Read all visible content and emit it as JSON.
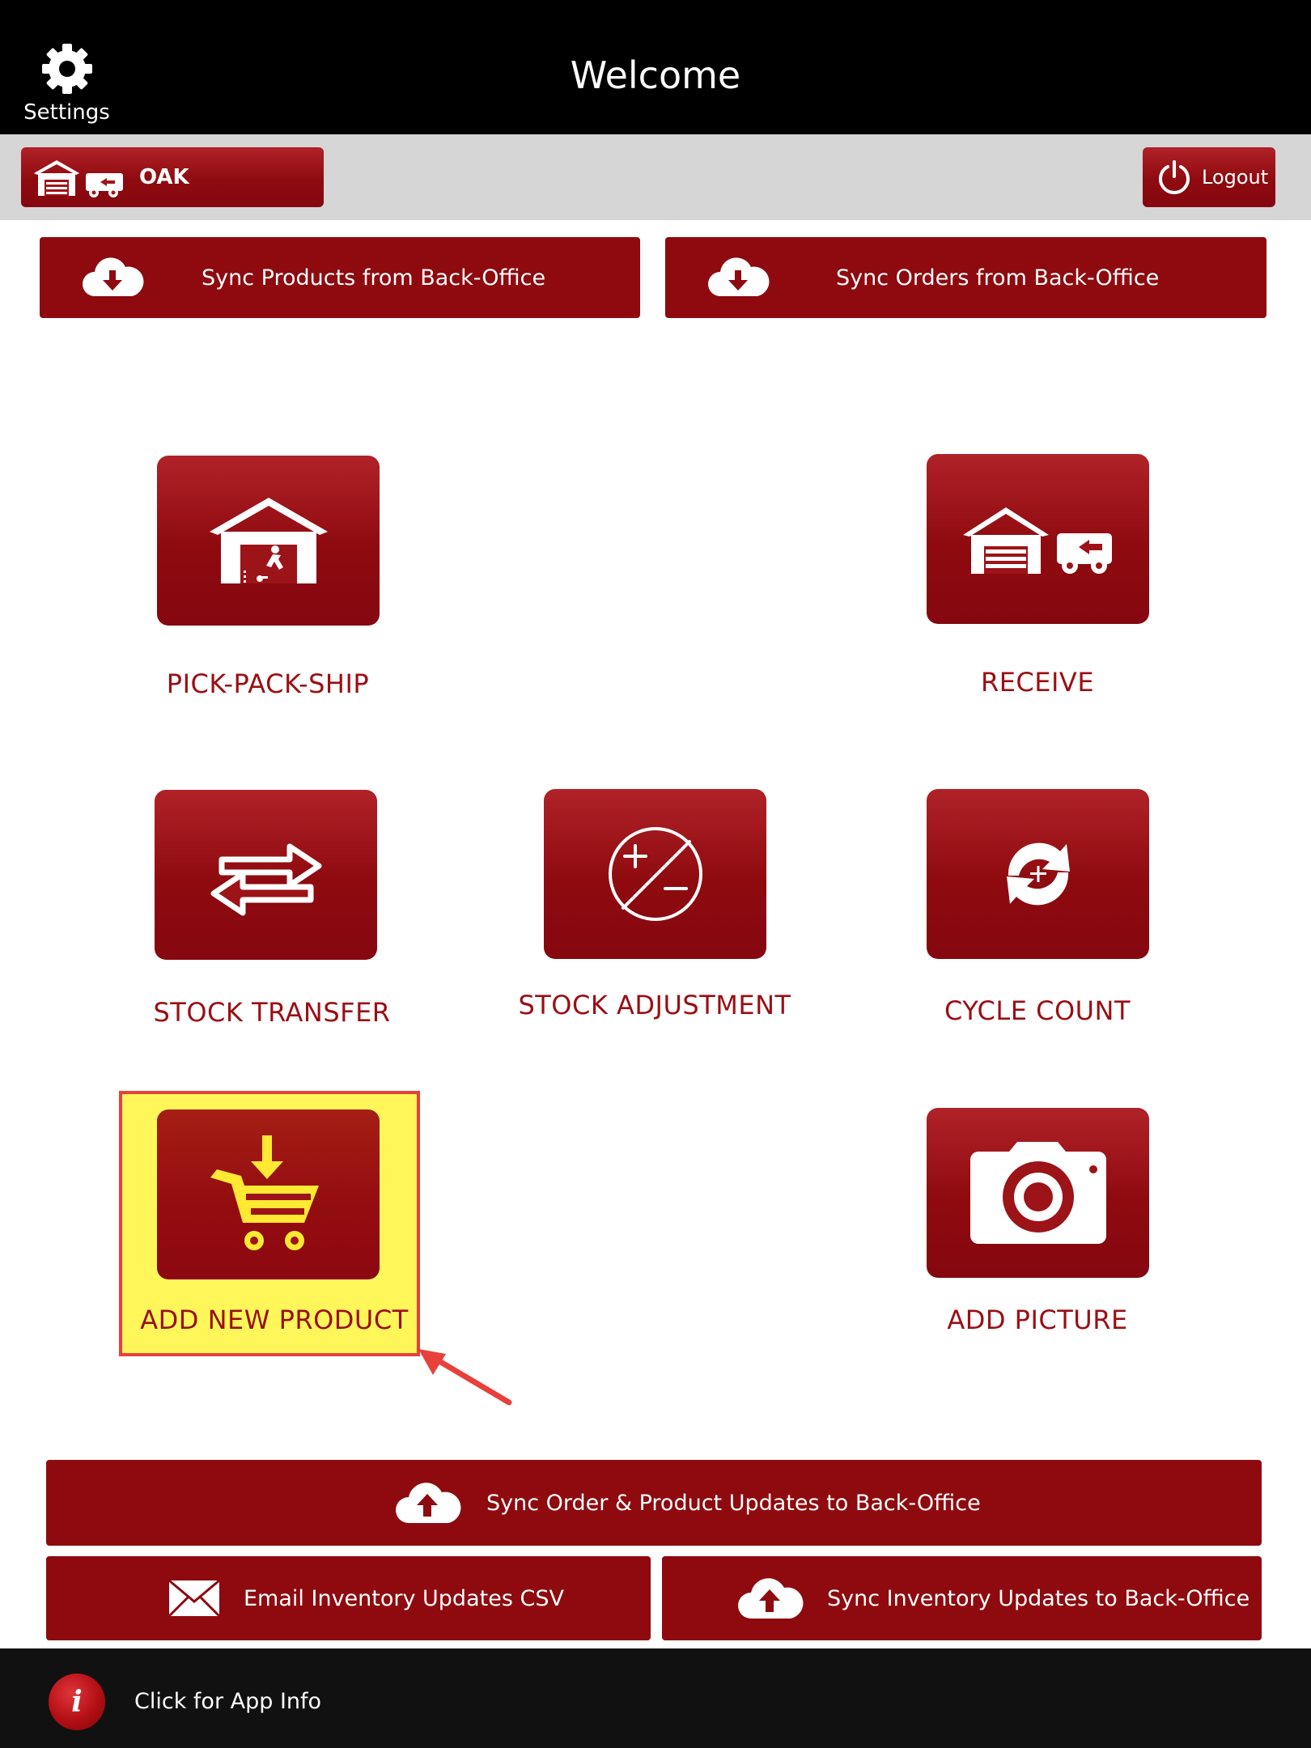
{
  "header": {
    "title": "Welcome",
    "settings_label": "Settings"
  },
  "subbar": {
    "location_label": "OAK",
    "logout_label": "Logout"
  },
  "top_sync": {
    "products_label": "Sync Products from Back-Office",
    "orders_label": "Sync Orders from Back-Office"
  },
  "tiles": {
    "pick_pack_ship": "PICK-PACK-SHIP",
    "receive": "RECEIVE",
    "stock_transfer": "STOCK TRANSFER",
    "stock_adjustment": "STOCK ADJUSTMENT",
    "cycle_count": "CYCLE COUNT",
    "add_new_product": "ADD NEW PRODUCT",
    "add_picture": "ADD PICTURE"
  },
  "bottom_sync": {
    "order_product_label": "Sync Order & Product Updates to Back-Office",
    "email_csv_label": "Email Inventory Updates CSV",
    "inventory_label": "Sync Inventory Updates to Back-Office"
  },
  "footer": {
    "info_label": "Click for App Info",
    "info_icon": "i"
  },
  "colors": {
    "brand_red": "#8e0a0f",
    "highlight": "#fff75a",
    "annotation": "#e8403a"
  }
}
